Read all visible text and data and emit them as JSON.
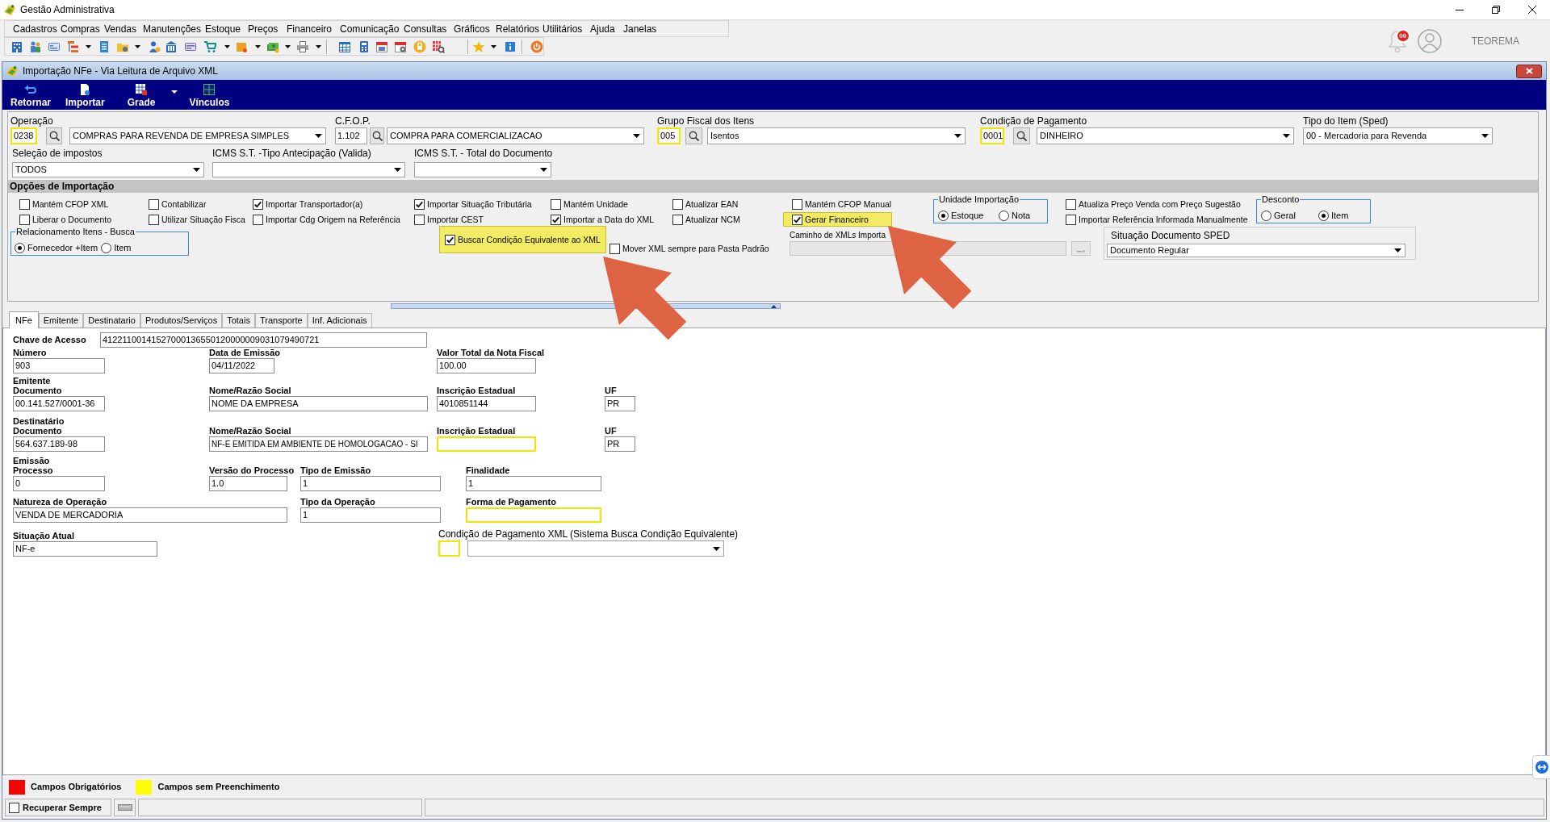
{
  "app_window": {
    "title": "Gestão Administrativa"
  },
  "menu_bar": [
    "Cadastros",
    "Compras",
    "Vendas",
    "Manutenções",
    "Estoque",
    "Preços",
    "Financeiro",
    "Comunicação",
    "Consultas",
    "Gráficos",
    "Relatórios",
    "Utilitários",
    "Ajuda",
    "Janelas"
  ],
  "notifications": {
    "badge": "00"
  },
  "user": {
    "name": "TEOREMA"
  },
  "document_window": {
    "title": "Importação NFe - Via Leitura de Arquivo XML",
    "actions": [
      {
        "label": "Retornar",
        "dropdown": false
      },
      {
        "label": "Importar",
        "dropdown": false
      },
      {
        "label": "Grade",
        "dropdown": true
      },
      {
        "label": "Vínculos",
        "dropdown": false
      }
    ],
    "lookups": [
      {
        "label": "Operação",
        "code": "0238",
        "highlighted": true,
        "value": "COMPRAS PARA REVENDA DE EMPRESA SIMPLES"
      },
      {
        "label": "C.F.O.P.",
        "code": "1.102",
        "highlighted": false,
        "value": "COMPRA PARA COMERCIALIZACAO"
      },
      {
        "label": "Grupo Fiscal dos Itens",
        "code": "005",
        "highlighted": true,
        "value": "Isentos"
      },
      {
        "label": "Condição de Pagamento",
        "code": "0001",
        "highlighted": true,
        "value": "DINHEIRO"
      },
      {
        "label": "Tipo do Item (Sped)",
        "value": "00 - Mercadoria para Revenda"
      }
    ],
    "tax_filters": [
      {
        "label": "Seleção de impostos",
        "value": "TODOS"
      },
      {
        "label": "ICMS S.T. -Tipo Antecipação (Valida)"
      },
      {
        "label": "ICMS S.T. - Total do Documento"
      }
    ],
    "import_options": {
      "title": "Opções de Importação",
      "row_1": [
        {
          "kind": "checks",
          "items": [
            {
              "label": "Mantém CFOP XML",
              "checked": false,
              "highlighted": false
            },
            {
              "label": "Liberar o Documento",
              "checked": false,
              "highlighted": false
            }
          ]
        },
        {
          "kind": "checks",
          "items": [
            {
              "label": "Contabilizar",
              "checked": false,
              "highlighted": false
            },
            {
              "label": "Utilizar Situação Fisca",
              "checked": false,
              "highlighted": false
            }
          ]
        },
        {
          "kind": "checks",
          "items": [
            {
              "label": "Importar Transportador(a)",
              "checked": true,
              "highlighted": false
            },
            {
              "label": "Importar Cdg Origem na Referência",
              "checked": false,
              "highlighted": false
            }
          ]
        },
        {
          "kind": "checks",
          "items": [
            {
              "label": "Importar Situação Tributária",
              "checked": true,
              "highlighted": false
            },
            {
              "label": "Importar CEST",
              "checked": false,
              "highlighted": false
            }
          ]
        },
        {
          "kind": "checks",
          "items": [
            {
              "label": "Mantém Unidade",
              "checked": false,
              "highlighted": false
            },
            {
              "label": "Importar a Data do XML",
              "checked": true,
              "highlighted": false
            }
          ]
        },
        {
          "kind": "checks",
          "items": [
            {
              "label": "Atualizar EAN",
              "checked": false,
              "highlighted": false
            },
            {
              "label": "Atualizar NCM",
              "checked": false,
              "highlighted": false
            }
          ]
        },
        {
          "kind": "checks",
          "items": [
            {
              "label": "Mantém CFOP Manual",
              "checked": false,
              "highlighted": false
            },
            {
              "label": "Gerar Financeiro",
              "checked": true,
              "highlighted": true
            }
          ]
        },
        {
          "kind": "radio_group",
          "title": "Unidade Importação",
          "options": [
            {
              "label": "Estoque",
              "selected": true
            },
            {
              "label": "Nota",
              "selected": false
            }
          ]
        },
        {
          "kind": "checks",
          "items": [
            {
              "label": "Atualiza Preço Venda com Preço Sugestão",
              "checked": false,
              "highlighted": false
            },
            {
              "label": "Importar Referência Informada Manualmente",
              "checked": false,
              "highlighted": false
            }
          ]
        },
        {
          "kind": "radio_group",
          "title": "Desconto",
          "options": [
            {
              "label": "Geral",
              "selected": false
            },
            {
              "label": "Item",
              "selected": true
            }
          ]
        }
      ],
      "row_2": [
        {
          "kind": "radio_group",
          "title": "Relacionamento Itens - Busca",
          "options": [
            {
              "label": "Fornecedor +Item",
              "selected": true
            },
            {
              "label": "Item",
              "selected": false
            }
          ]
        },
        {
          "kind": "check",
          "label": "Buscar Condição Equivalente ao XML",
          "checked": true,
          "highlighted": true
        },
        {
          "kind": "check",
          "label": "Mover XML sempre para Pasta Padrão",
          "checked": false,
          "highlighted": false
        },
        {
          "kind": "path_field",
          "label": "Caminho de XMLs Importa",
          "disabled": true
        },
        {
          "kind": "select_group",
          "label": "Situação Documento SPED",
          "value": "Documento Regular"
        }
      ]
    },
    "tabs": [
      {
        "label": "NFe",
        "selected": true
      },
      {
        "label": "Emitente",
        "selected": false
      },
      {
        "label": "Destinatario",
        "selected": false
      },
      {
        "label": "Produtos/Serviços",
        "selected": false
      },
      {
        "label": "Totais",
        "selected": false
      },
      {
        "label": "Transporte",
        "selected": false
      },
      {
        "label": "Inf. Adicionais",
        "selected": false
      }
    ],
    "nfe": {
      "access_key": {
        "label": "Chave de Acesso",
        "value": "41221100141527000136550120000009031079490721"
      },
      "fields": [
        {
          "kind": "text",
          "label": "Número",
          "value": "903",
          "highlighted": false
        },
        {
          "kind": "text",
          "label": "Data de Emissão",
          "value": "04/11/2022",
          "highlighted": false
        },
        {
          "kind": "text",
          "label": "Valor Total da Nota Fiscal",
          "value": "100.00",
          "highlighted": false
        },
        {
          "kind": "text",
          "group": "Emitente",
          "label": "Documento",
          "value": "00.141.527/0001-36",
          "highlighted": false
        },
        {
          "kind": "text",
          "label": "Nome/Razão Social",
          "value": "NOME DA EMPRESA",
          "highlighted": false
        },
        {
          "kind": "text",
          "label": "Inscrição Estadual",
          "value": "4010851144",
          "highlighted": false
        },
        {
          "kind": "text",
          "label": "UF",
          "value": "PR",
          "highlighted": false
        },
        {
          "kind": "text",
          "group": "Destinatário",
          "label": "Documento",
          "value": "564.637.189-98",
          "highlighted": false
        },
        {
          "kind": "text",
          "label": "Nome/Razão Social",
          "value": "NF-E EMITIDA EM AMBIENTE DE HOMOLOGACAO - SI",
          "highlighted": false
        },
        {
          "kind": "text",
          "label": "Inscrição Estadual",
          "highlighted": true
        },
        {
          "kind": "text",
          "label": "UF",
          "value": "PR",
          "highlighted": false
        },
        {
          "kind": "text",
          "group": "Emissão",
          "label": "Processo",
          "value": "0",
          "highlighted": false
        },
        {
          "kind": "text",
          "label": "Versão do Processo",
          "value": "1.0",
          "highlighted": false
        },
        {
          "kind": "text",
          "label": "Tipo de Emissão",
          "value": "1",
          "highlighted": false
        },
        {
          "kind": "text",
          "label": "Finalidade",
          "value": "1",
          "highlighted": false
        },
        {
          "kind": "text",
          "label": "Natureza de Operação",
          "value": "VENDA DE MERCADORIA",
          "highlighted": false
        },
        {
          "kind": "text",
          "label": "Tipo da Operação",
          "value": "1",
          "highlighted": false
        },
        {
          "kind": "text",
          "label": "Forma de Pagamento",
          "highlighted": true
        },
        {
          "kind": "text",
          "label": "Situação Atual",
          "value": "NF-e",
          "highlighted": false
        },
        {
          "kind": "code_select",
          "label": "Condição de Pagamento XML (Sistema Busca Condição Equivalente)",
          "highlighted": true
        }
      ]
    },
    "legend": [
      {
        "label": "Campos Obrigatórios",
        "color": "#ff0000"
      },
      {
        "label": "Campos sem Preenchimento",
        "color": "#ffff00"
      }
    ],
    "status_bar": {
      "label": "Recuperar Sempre",
      "checked": false
    }
  },
  "annotations": [
    {
      "kind": "arrow"
    },
    {
      "kind": "arrow"
    }
  ]
}
